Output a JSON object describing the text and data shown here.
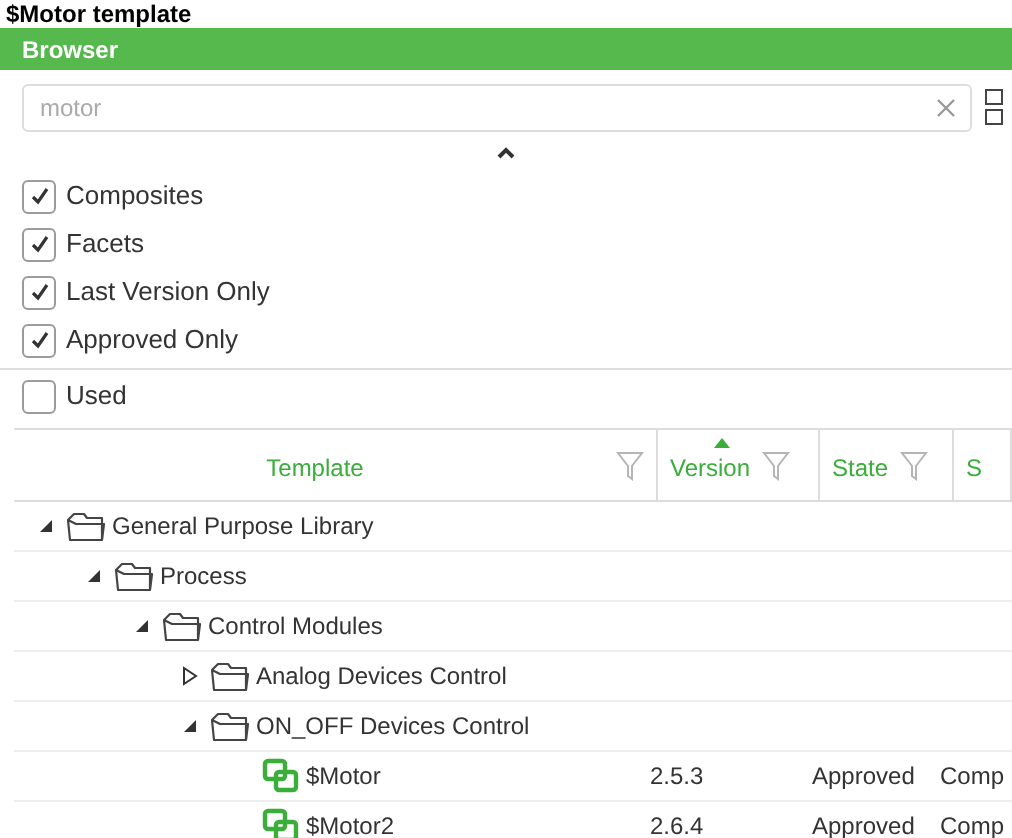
{
  "page_title": "$Motor template",
  "panel": {
    "title": "Browser"
  },
  "search": {
    "value": "motor"
  },
  "filters": [
    {
      "label": "Composites",
      "checked": true
    },
    {
      "label": "Facets",
      "checked": true
    },
    {
      "label": "Last Version Only",
      "checked": true
    },
    {
      "label": "Approved Only",
      "checked": true
    }
  ],
  "used_filter": {
    "label": "Used",
    "checked": false
  },
  "table": {
    "columns": [
      {
        "label": "Template",
        "filter": true,
        "sorted": false
      },
      {
        "label": "Version",
        "filter": true,
        "sorted": true
      },
      {
        "label": "State",
        "filter": true,
        "sorted": false
      },
      {
        "label": "S",
        "filter": false,
        "sorted": false
      }
    ],
    "rows": [
      {
        "kind": "folder",
        "name": "General Purpose Library",
        "expanded": true,
        "children": [
          {
            "kind": "folder",
            "name": "Process",
            "expanded": true,
            "children": [
              {
                "kind": "folder",
                "name": "Control Modules",
                "expanded": true,
                "children": [
                  {
                    "kind": "folder",
                    "name": "Analog Devices Control",
                    "expanded": false
                  },
                  {
                    "kind": "folder",
                    "name": "ON_OFF Devices Control",
                    "expanded": true,
                    "children": [
                      {
                        "kind": "template",
                        "name": "$Motor",
                        "version": "2.5.3",
                        "state": "Approved",
                        "column_4": "Comp"
                      },
                      {
                        "kind": "template",
                        "name": "$Motor2",
                        "version": "2.6.4",
                        "state": "Approved",
                        "column_4": "Comp"
                      }
                    ]
                  }
                ]
              }
            ]
          }
        ]
      }
    ]
  }
}
